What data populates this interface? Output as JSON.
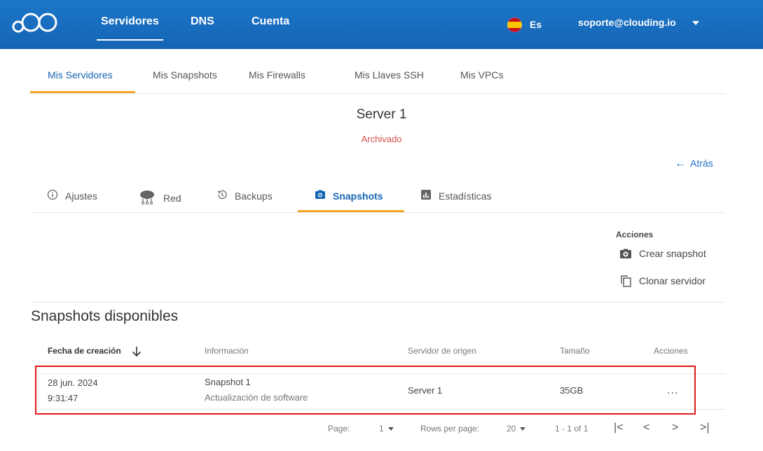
{
  "topbar": {
    "nav": [
      {
        "label": "Servidores"
      },
      {
        "label": "DNS"
      },
      {
        "label": "Cuenta"
      }
    ],
    "language": "Es",
    "account_email": "soporte@clouding.io"
  },
  "subnav": {
    "items": [
      {
        "label": "Mis Servidores"
      },
      {
        "label": "Mis Snapshots"
      },
      {
        "label": "Mis Firewalls"
      },
      {
        "label": "Mis Llaves SSH"
      },
      {
        "label": "Mis VPCs"
      }
    ]
  },
  "server": {
    "name": "Server 1",
    "status": "Archivado",
    "back_label": "Atrás"
  },
  "server_tabs": [
    {
      "label": "Ajustes",
      "icon": "info-icon"
    },
    {
      "label": "Red",
      "icon": "network-icon"
    },
    {
      "label": "Backups",
      "icon": "history-icon"
    },
    {
      "label": "Snapshots",
      "icon": "camera-icon"
    },
    {
      "label": "Estadísticas",
      "icon": "bar-chart-icon"
    }
  ],
  "actions": {
    "title": "Acciones",
    "create_snapshot": "Crear snapshot",
    "clone_server": "Clonar servidor"
  },
  "snapshots": {
    "title": "Snapshots disponibles",
    "columns": [
      "Fecha de creación",
      "Información",
      "Servidor de origen",
      "Tamaño",
      "Acciones"
    ],
    "rows": [
      {
        "date": "28 jun. 2024",
        "time": "9:31:47",
        "name": "Snapshot 1",
        "description": "Actualización de software",
        "origin_server": "Server 1",
        "size": "35GB",
        "actions_label": "..."
      }
    ]
  },
  "pagination": {
    "page_label": "Page:",
    "page_value": "1",
    "rows_label": "Rows per page:",
    "rows_value": "20",
    "range": "1 - 1 of 1"
  },
  "colors": {
    "topbar": "#1565b5",
    "accent_underline": "#f5a623",
    "status_archived": "#d94b4b",
    "highlight_box": "#e01919"
  }
}
